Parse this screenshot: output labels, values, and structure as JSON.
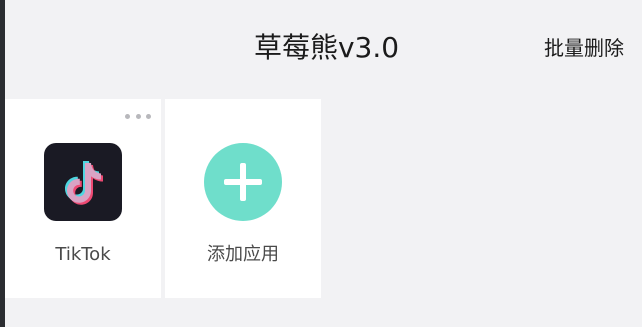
{
  "header": {
    "title": "草莓熊v3.0",
    "batch_delete_label": "批量删除"
  },
  "apps": [
    {
      "label": "TikTok",
      "icon": "tiktok-icon"
    },
    {
      "label": "添加应用",
      "icon": "add-icon"
    }
  ],
  "colors": {
    "background": "#f2f2f4",
    "card": "#ffffff",
    "add_accent": "#6fdecb",
    "tiktok_bg": "#1a1a24"
  }
}
